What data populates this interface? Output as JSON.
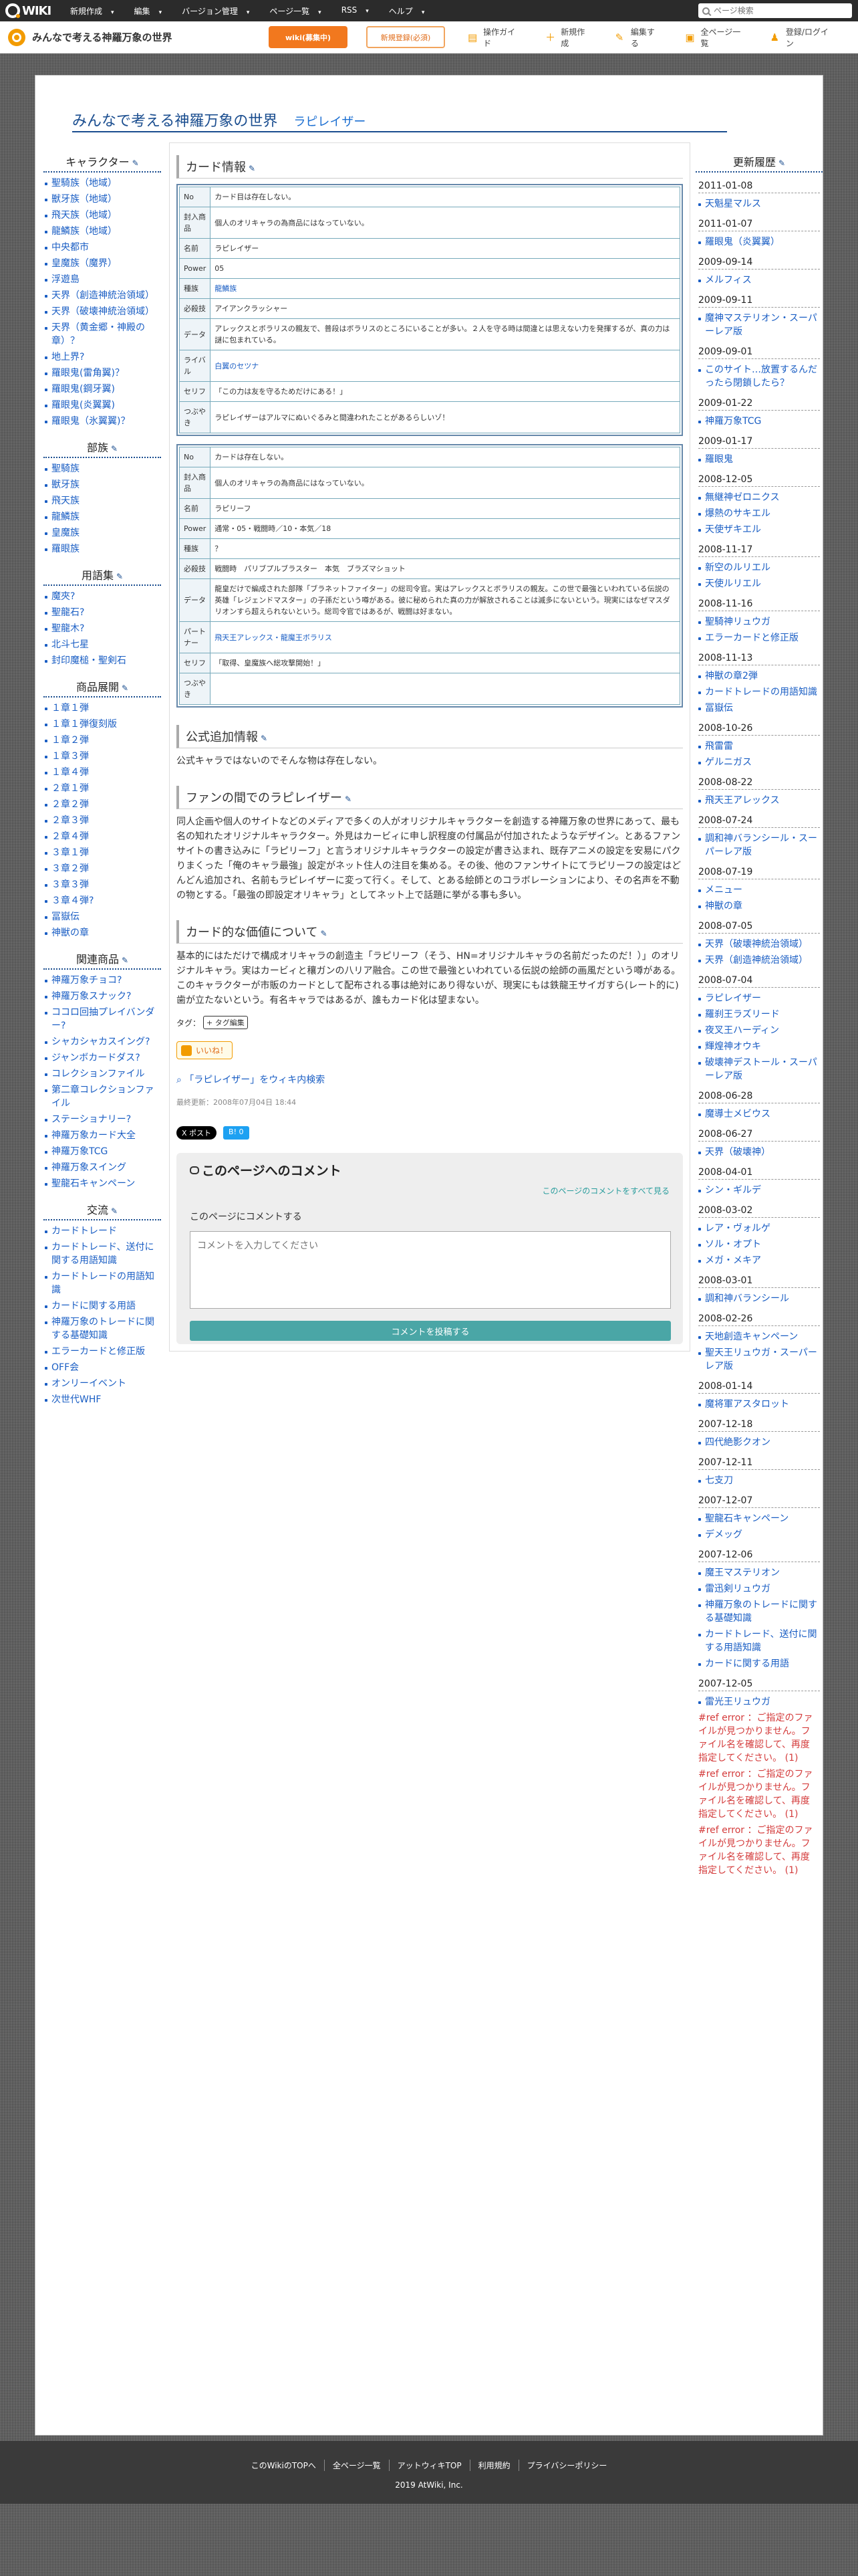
{
  "topbar": {
    "logo": "WIKI",
    "menu": [
      "新規作成",
      "編集",
      "バージョン管理",
      "ページ一覧",
      "RSS",
      "ヘルプ"
    ],
    "search_placeholder": "ページ検索"
  },
  "subbar": {
    "site_name": "みんなで考える神羅万象の世界",
    "btn_primary": "wiki(募集中)",
    "btn_secondary": "新規登録(必須)",
    "tools": [
      "操作ガイド",
      "新規作成",
      "編集する",
      "全ページ一覧",
      "登録/ログイン"
    ]
  },
  "page": {
    "title": "みんなで考える神羅万象の世界",
    "subtitle": "ラピレイザー"
  },
  "leftmenu": {
    "sections": [
      {
        "head": "キャラクター",
        "items": [
          "聖騎族（地域）",
          "獣牙族（地域）",
          "飛天族（地域）",
          "龍鱗族（地域）",
          "中央都市",
          "皇魔族（魔界）",
          "浮遊島",
          "天界（創造神統治領域）",
          "天界（破壊神統治領域）",
          "天界（黄金郷・神殿の章）？",
          "地上界?",
          "羅眼鬼(雷角翼)？",
          "羅眼鬼(鋼牙翼)",
          "羅眼鬼(炎翼翼)",
          "羅眼鬼（氷翼翼)？"
        ]
      },
      {
        "head": "部族",
        "items": [
          "聖騎族",
          "獣牙族",
          "飛天族",
          "龍鱗族",
          "皇魔族",
          "羅眼族"
        ]
      },
      {
        "head": "用語集",
        "items": [
          "魔夾?",
          "聖龍石?",
          "聖龍木?",
          "北斗七星",
          "封印魔槌・聖剣石"
        ]
      },
      {
        "head": "商品展開",
        "items": [
          "１章１弾",
          "１章１弾復刻版",
          "１章２弾",
          "１章３弾",
          "１章４弾",
          "２章１弾",
          "２章２弾",
          "２章３弾",
          "２章４弾",
          "３章１弾",
          "３章２弾",
          "３章３弾",
          "３章４弾?",
          "冨嶽伝",
          "神獣の章"
        ]
      },
      {
        "head": "関連商品",
        "items": [
          "神羅万象チョコ?",
          "神羅万象スナック?",
          "ココロ回抽プレイバンダー?",
          "シャカシャカスイング?",
          "ジャンボカードダス?",
          "コレクションファイル",
          "第二章コレクションファイル",
          "ステーショナリー?",
          "神羅万象カード大全",
          "神羅万象TCG",
          "神羅万象スイング",
          "聖龍石キャンペーン"
        ]
      },
      {
        "head": "交流",
        "items": [
          "カードトレード",
          "カードトレード、送付に関する用語知識",
          "カードトレードの用語知識",
          "カードに関する用語",
          "神羅万象のトレードに関する基礎知識",
          "エラーカードと修正版",
          "OFF会",
          "オンリーイベント",
          "次世代WHF"
        ]
      }
    ]
  },
  "content": {
    "card_title": "カード情報",
    "card1": [
      {
        "k": "No",
        "v": "カード目は存在しない。"
      },
      {
        "k": "封入商品",
        "v": "個人のオリキャラの為商品にはなっていない。"
      },
      {
        "k": "名前",
        "v": "ラピレイザー"
      },
      {
        "k": "Power",
        "v": "05"
      },
      {
        "k": "種族",
        "v": "龍鱗族",
        "link": true
      },
      {
        "k": "必殺技",
        "v": "アイアンクラッシャー"
      },
      {
        "k": "データ",
        "v": "アレックスとボラリスの親友で、普段はボラリスのところにいることが多い。２人を守る時は間違とは思えない力を発揮するが、真の力は謎に包まれている。"
      },
      {
        "k": "ライバル",
        "v": "白翼のセツナ",
        "link": true
      },
      {
        "k": "セリフ",
        "v": "「この力は友を守るためだけにある！」"
      },
      {
        "k": "つぶやき",
        "v": "ラピレイザーはアルマにぬいぐるみと間違われたことがあるらしいゾ！"
      }
    ],
    "card2": [
      {
        "k": "No",
        "v": "カードは存在しない。"
      },
      {
        "k": "封入商品",
        "v": "個人のオリキャラの為商品にはなっていない。"
      },
      {
        "k": "名前",
        "v": "ラピリーフ"
      },
      {
        "k": "Power",
        "v": "通常・05・戦闘時／10・本気／18"
      },
      {
        "k": "種族",
        "v": "？"
      },
      {
        "k": "必殺技",
        "v": "戦闘時　パリブプルブラスター　本気　ブラズマショット"
      },
      {
        "k": "データ",
        "v": "龍皇だけで編成された部隊「ブラネットファイター」の総司令官。実はアレックスとボラリスの親友。この世で最強といわれている伝説の英雄「レジェンドマスター」の子孫だという噂がある。彼に秘められた真の力が解放されることは滅多にないという。現実にはなぜマスダリオンすら超えられないという。総司令官ではあるが、戦闘は好まない。"
      },
      {
        "k": "パートナー",
        "v": "飛天王アレックス・龍魔王ボラリス",
        "link": true
      },
      {
        "k": "セリフ",
        "v": "「取得、皇魔族へ総攻撃開始！」"
      },
      {
        "k": "つぶやき",
        "v": ""
      }
    ],
    "sec_official": "公式追加情報",
    "official_text": "公式キャラではないのでそんな物は存在しない。",
    "sec_fan": "ファンの間でのラピレイザー",
    "fan_text": "同人企画や個人のサイトなどのメディアで多くの人がオリジナルキャラクターを創造する神羅万象の世界にあって、最も名の知れたオリジナルキャラクター。外見はカービィに申し訳程度の付属品が付加されたようなデザイン。とあるファンサイトの書き込みに「ラピリーフ」と言うオリジナルキャラクターの設定が書き込まれ、既存アニメの設定を安易にパクりまくった「俺のキャラ最強」設定がネット住人の注目を集める。その後、他のファンサイトにてラピリーフの設定はどんどん追加され、名前もラピレイザーに変って行く。そして、とある絵師とのコラボレーションにより、その名声を不動の物とする。「最強の即設定オリキャラ」としてネット上で話題に挙がる事も多い。",
    "sec_value": "カード的な価値について",
    "value_text": "基本的にはただけで構成オリキャラの創造主「ラピリーフ（そう、HN=オリジナルキャラの名前だったのだ！）」のオリジナルキャラ。実はカービィと穰ガンの八リア融合。この世で最強といわれている伝説の絵師の画風だという噂がある。このキャラクターが市販のカードとして配布される事は絶対にあり得ないが、現実にもは鉄龍王サイガすら(レート的に)歯が立たないという。有名キャラではあるが、誰もカード化は望まない。",
    "tag_label": "タグ：",
    "tag_button": "+ タグ編集",
    "like": "いいね！",
    "wiki_search": "「ラピレイザー」をウィキ内検索",
    "updated": "最終更新：2008年07月04日 18:44",
    "share_x": "X ポスト",
    "share_b": "B! 0"
  },
  "comments": {
    "title": "このページへのコメント",
    "view_all": "このページのコメントをすべて見る",
    "label": "このページにコメントする",
    "placeholder": "コメントを入力してください",
    "post": "コメントを投稿する"
  },
  "rightcol": {
    "head": "更新履歴",
    "groups": [
      {
        "date": "2011-01-08",
        "items": [
          "天魁星マルス"
        ]
      },
      {
        "date": "2011-01-07",
        "items": [
          "羅眼鬼（炎翼翼）"
        ]
      },
      {
        "date": "2009-09-14",
        "items": [
          "メルフィス"
        ]
      },
      {
        "date": "2009-09-11",
        "items": [
          "魔神マステリオン・スーパーレア版"
        ]
      },
      {
        "date": "2009-09-01",
        "items": [
          "このサイト…放置するんだったら閉鎖したら？"
        ]
      },
      {
        "date": "2009-01-22",
        "items": [
          "神羅万象TCG"
        ]
      },
      {
        "date": "2009-01-17",
        "items": [
          "羅眼鬼"
        ]
      },
      {
        "date": "2008-12-05",
        "items": [
          "無継神ゼロニクス",
          "爆熱のサキエル",
          "天使ザキエル"
        ]
      },
      {
        "date": "2008-11-17",
        "items": [
          "新空のルリエル",
          "天使ルリエル"
        ]
      },
      {
        "date": "2008-11-16",
        "items": [
          "聖騎神リュウガ",
          "エラーカードと修正版"
        ]
      },
      {
        "date": "2008-11-13",
        "items": [
          "神獣の章2弾",
          "カードトレードの用語知識",
          "冨嶽伝"
        ]
      },
      {
        "date": "2008-10-26",
        "items": [
          "飛雷雷",
          "ゲルニガス"
        ]
      },
      {
        "date": "2008-08-22",
        "items": [
          "飛天王アレックス"
        ]
      },
      {
        "date": "2008-07-24",
        "items": [
          "調和神バランシール・スーパーレア版"
        ]
      },
      {
        "date": "2008-07-19",
        "items": [
          "メニュー",
          "神獣の章"
        ]
      },
      {
        "date": "2008-07-05",
        "items": [
          "天界（破壊神統治領域）",
          "天界（創造神統治領域）"
        ]
      },
      {
        "date": "2008-07-04",
        "items": [
          "ラピレイザー",
          "羅刹王ラズリード",
          "夜叉王ハーディン",
          "輝煌神オウキ",
          "破壊神デストール・スーパーレア版"
        ]
      },
      {
        "date": "2008-06-28",
        "items": [
          "魔導士メビウス"
        ]
      },
      {
        "date": "2008-06-27",
        "items": [
          "天界（破壊神）"
        ]
      },
      {
        "date": "2008-04-01",
        "items": [
          "シン・ギルデ"
        ]
      },
      {
        "date": "2008-03-02",
        "items": [
          "レア・ヴォルゲ",
          "ソル・オプト",
          "メガ・メキア"
        ]
      },
      {
        "date": "2008-03-01",
        "items": [
          "調和神バランシール"
        ]
      },
      {
        "date": "2008-02-26",
        "items": [
          "天地創造キャンペーン",
          "聖天王リュウガ・スーパーレア版"
        ]
      },
      {
        "date": "2008-01-14",
        "items": [
          "魔将軍アスタロット"
        ]
      },
      {
        "date": "2007-12-18",
        "items": [
          "四代絶影クオン"
        ]
      },
      {
        "date": "2007-12-11",
        "items": [
          "七支刀"
        ]
      },
      {
        "date": "2007-12-07",
        "items": [
          "聖龍石キャンペーン",
          "デメッグ"
        ]
      },
      {
        "date": "2007-12-06",
        "items": [
          "魔王マステリオン",
          "雷迅剣リュウガ",
          "神羅万象のトレードに関する基礎知識",
          "カードトレード、送付に関する用語知識",
          "カードに関する用語"
        ]
      },
      {
        "date": "2007-12-05",
        "items": [
          "雷光王リュウガ"
        ]
      }
    ],
    "errors": [
      "#ref error ：ご指定のファイルが見つかりません。ファイル名を確認して、再度指定してください。 (1)",
      "#ref error ：ご指定のファイルが見つかりません。ファイル名を確認して、再度指定してください。 (1)",
      "#ref error ：ご指定のファイルが見つかりません。ファイル名を確認して、再度指定してください。 (1)"
    ]
  },
  "footer": {
    "links": [
      "このWikiのTOPへ",
      "全ページ一覧",
      "アットウィキTOP",
      "利用規約",
      "プライバシーポリシー"
    ],
    "copy": "2019 AtWiki, Inc."
  }
}
